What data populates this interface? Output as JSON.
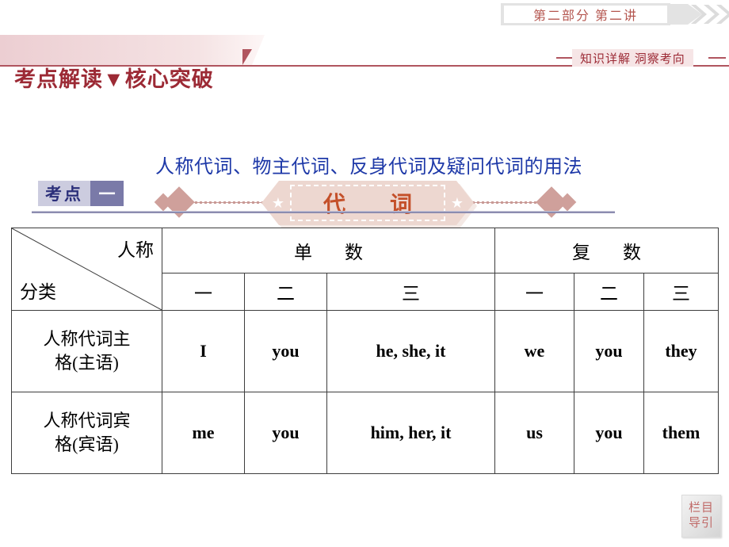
{
  "topbar": {
    "tab_label": "第二部分  第二讲",
    "chevrons_icon": "double-chevron-right-icon"
  },
  "header": {
    "banner_title": "考点解读▼核心突破",
    "sub_label": "知识详解  洞察考向",
    "accent_red": "#9c2a35",
    "rule_color": "#b0555f"
  },
  "title_banner": {
    "text": "代　词",
    "star_left_icon": "star-icon",
    "star_right_icon": "star-icon",
    "diamond_left_icon": "diamond-icon",
    "diamond_right_icon": "diamond-icon",
    "fill": "#edd7d0",
    "text_color": "#c4502a"
  },
  "section": {
    "badge_label": "考点",
    "badge_number": "一",
    "title": "人称代词、物主代词、反身代词及疑问代词的用法",
    "title_color": "#1e39a8",
    "badge_bg": "#ccccdf",
    "badge_num_bg": "#7a7aa8"
  },
  "table": {
    "corner_top_right": "人称",
    "corner_bottom_left": "分类",
    "group_headers": [
      "单　数",
      "复　数"
    ],
    "person_headers": [
      "一",
      "二",
      "三",
      "一",
      "二",
      "三"
    ],
    "rows": [
      {
        "label_line1": "人称代词主",
        "label_line2": "格(主语)",
        "cells": [
          "I",
          "you",
          "he, she, it",
          "we",
          "you",
          "they"
        ]
      },
      {
        "label_line1": "人称代词宾",
        "label_line2": "格(宾语)",
        "cells": [
          "me",
          "you",
          "him, her, it",
          "us",
          "you",
          "them"
        ]
      }
    ]
  },
  "footer": {
    "corner_button_line1": "栏目",
    "corner_button_line2": "导引"
  }
}
